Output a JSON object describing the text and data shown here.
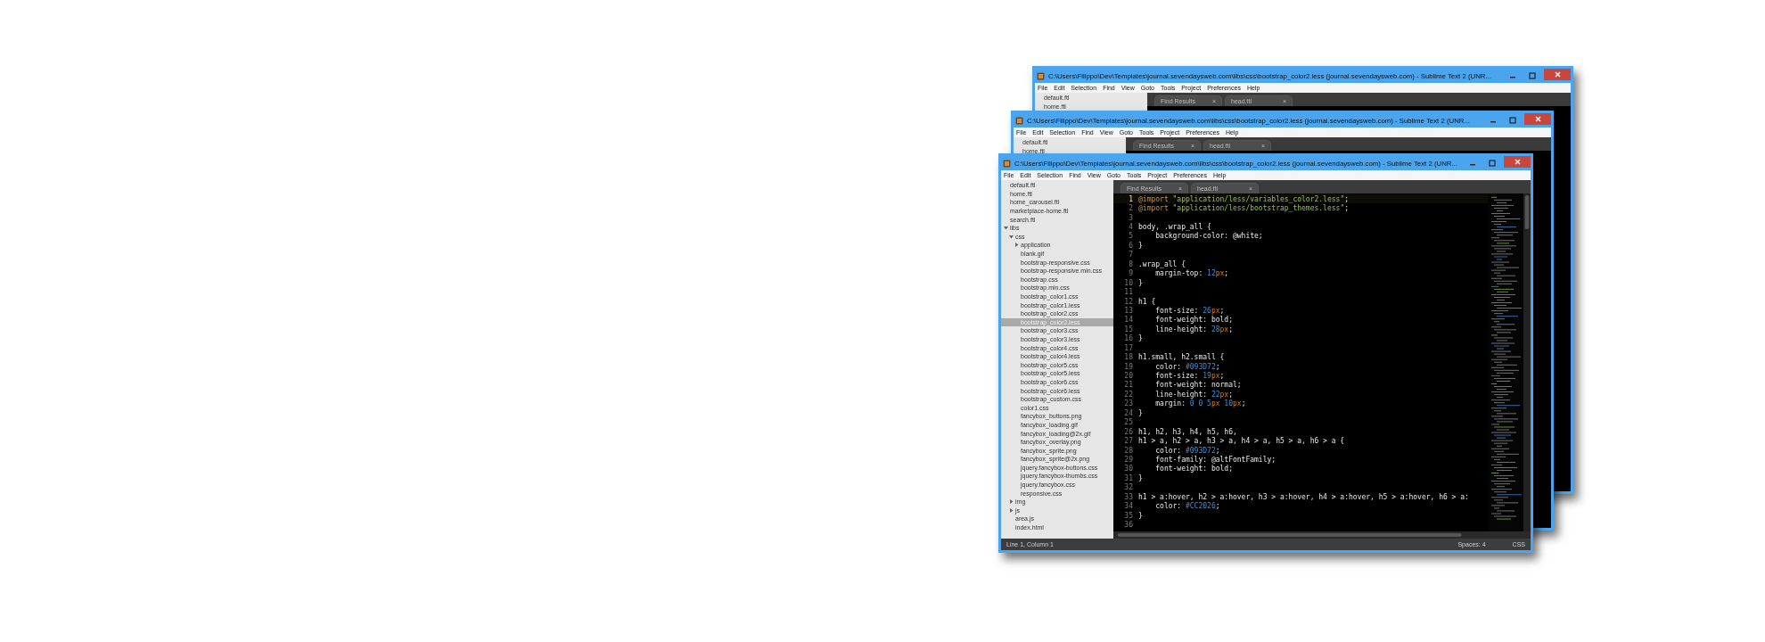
{
  "windows": [
    {
      "title": "C:\\Users\\Filippo\\Dev\\Templates\\journal.sevendaysweb.com\\libs\\css\\bootstrap_color2.less (journal.sevendaysweb.com) - Sublime Text 2 (UNR...",
      "menu": [
        "File",
        "Edit",
        "Selection",
        "Find",
        "View",
        "Goto",
        "Tools",
        "Project",
        "Preferences",
        "Help"
      ],
      "sidebar": {
        "items": [
          {
            "kind": "file",
            "label": "default.ftl",
            "selected": false
          },
          {
            "kind": "file",
            "label": "home.ftl",
            "selected": false
          }
        ]
      },
      "tabs": [
        {
          "label": "Find Results",
          "close": "×",
          "selected": false
        },
        {
          "label": "head.ftl",
          "close": "×",
          "selected": false
        }
      ]
    },
    {
      "title": "C:\\Users\\Filippo\\Dev\\Templates\\journal.sevendaysweb.com\\libs\\css\\bootstrap_color2.less (journal.sevendaysweb.com) - Sublime Text 2 (UNR...",
      "menu": [
        "File",
        "Edit",
        "Selection",
        "Find",
        "View",
        "Goto",
        "Tools",
        "Project",
        "Preferences",
        "Help"
      ],
      "sidebar": {
        "items": [
          {
            "kind": "file",
            "label": "default.ftl",
            "selected": false
          },
          {
            "kind": "file",
            "label": "home.ftl",
            "selected": false
          }
        ]
      },
      "tabs": [
        {
          "label": "Find Results",
          "close": "×",
          "selected": false
        },
        {
          "label": "head.ftl",
          "close": "×",
          "selected": false
        }
      ]
    },
    {
      "title": "C:\\Users\\Filippo\\Dev\\Templates\\journal.sevendaysweb.com\\libs\\css\\bootstrap_color2.less (journal.sevendaysweb.com) - Sublime Text 2 (UNR...",
      "menu": [
        "File",
        "Edit",
        "Selection",
        "Find",
        "View",
        "Goto",
        "Tools",
        "Project",
        "Preferences",
        "Help"
      ],
      "sidebar": {
        "items": [
          {
            "kind": "file",
            "label": "default.ftl",
            "selected": false
          },
          {
            "kind": "file",
            "label": "home.ftl",
            "selected": false
          },
          {
            "kind": "file",
            "label": "home_carousel.ftl",
            "selected": false
          },
          {
            "kind": "file",
            "label": "marketplace-home.ftl",
            "selected": false
          },
          {
            "kind": "file",
            "label": "search.ftl",
            "selected": false
          },
          {
            "kind": "folder",
            "label": "libs",
            "selected": false,
            "expanded": true,
            "children": [
              {
                "kind": "folder",
                "label": "css",
                "selected": false,
                "expanded": true,
                "children": [
                  {
                    "kind": "folder",
                    "label": "application",
                    "selected": false,
                    "expanded": false
                  },
                  {
                    "kind": "file",
                    "label": "blank.gif",
                    "selected": false
                  },
                  {
                    "kind": "file",
                    "label": "bootstrap-responsive.css",
                    "selected": false
                  },
                  {
                    "kind": "file",
                    "label": "bootstrap-responsive.min.css",
                    "selected": false
                  },
                  {
                    "kind": "file",
                    "label": "bootstrap.css",
                    "selected": false
                  },
                  {
                    "kind": "file",
                    "label": "bootstrap.min.css",
                    "selected": false
                  },
                  {
                    "kind": "file",
                    "label": "bootstrap_color1.css",
                    "selected": false
                  },
                  {
                    "kind": "file",
                    "label": "bootstrap_color1.less",
                    "selected": false
                  },
                  {
                    "kind": "file",
                    "label": "bootstrap_color2.css",
                    "selected": false
                  },
                  {
                    "kind": "file",
                    "label": "bootstrap_color2.less",
                    "selected": true
                  },
                  {
                    "kind": "file",
                    "label": "bootstrap_color3.css",
                    "selected": false
                  },
                  {
                    "kind": "file",
                    "label": "bootstrap_color3.less",
                    "selected": false
                  },
                  {
                    "kind": "file",
                    "label": "bootstrap_color4.css",
                    "selected": false
                  },
                  {
                    "kind": "file",
                    "label": "bootstrap_color4.less",
                    "selected": false
                  },
                  {
                    "kind": "file",
                    "label": "bootstrap_color5.css",
                    "selected": false
                  },
                  {
                    "kind": "file",
                    "label": "bootstrap_color5.less",
                    "selected": false
                  },
                  {
                    "kind": "file",
                    "label": "bootstrap_color6.css",
                    "selected": false
                  },
                  {
                    "kind": "file",
                    "label": "bootstrap_color6.less",
                    "selected": false
                  },
                  {
                    "kind": "file",
                    "label": "bootstrap_custom.css",
                    "selected": false
                  },
                  {
                    "kind": "file",
                    "label": "color1.css",
                    "selected": false
                  },
                  {
                    "kind": "file",
                    "label": "fancybox_buttons.png",
                    "selected": false
                  },
                  {
                    "kind": "file",
                    "label": "fancybox_loading.gif",
                    "selected": false
                  },
                  {
                    "kind": "file",
                    "label": "fancybox_loading@2x.gif",
                    "selected": false
                  },
                  {
                    "kind": "file",
                    "label": "fancybox_overlay.png",
                    "selected": false
                  },
                  {
                    "kind": "file",
                    "label": "fancybox_sprite.png",
                    "selected": false
                  },
                  {
                    "kind": "file",
                    "label": "fancybox_sprite@2x.png",
                    "selected": false
                  },
                  {
                    "kind": "file",
                    "label": "jquery.fancybox-buttons.css",
                    "selected": false
                  },
                  {
                    "kind": "file",
                    "label": "jquery.fancybox-thumbs.css",
                    "selected": false
                  },
                  {
                    "kind": "file",
                    "label": "jquery.fancybox.css",
                    "selected": false
                  },
                  {
                    "kind": "file",
                    "label": "responsive.css",
                    "selected": false
                  }
                ]
              },
              {
                "kind": "folder",
                "label": "img",
                "selected": false,
                "expanded": false
              },
              {
                "kind": "folder",
                "label": "js",
                "selected": false,
                "expanded": false
              },
              {
                "kind": "file",
                "label": "area.js",
                "selected": false
              },
              {
                "kind": "file",
                "label": "index.html",
                "selected": false
              }
            ]
          }
        ]
      },
      "tabs": [
        {
          "label": "Find Results",
          "close": "×",
          "selected": false
        },
        {
          "label": "head.ftl",
          "close": "×",
          "selected": false
        }
      ],
      "editor": {
        "lines": [
          {
            "number": "1",
            "current": true,
            "parts": [
              {
                "kind": "keyword",
                "text": "@import"
              },
              {
                "kind": "string",
                "text": " \"application/less/variables_color2.less\""
              },
              {
                "kind": "text",
                "text": ";"
              }
            ]
          },
          {
            "number": "2",
            "current": false,
            "parts": [
              {
                "kind": "keyword",
                "text": "@import"
              },
              {
                "kind": "string",
                "text": " \"application/less/bootstrap_themes.less\""
              },
              {
                "kind": "text",
                "text": ";"
              }
            ]
          },
          {
            "number": "3",
            "current": false
          },
          {
            "number": "4",
            "current": false,
            "parts": [
              {
                "kind": "text",
                "text": "body, .wrap_all {"
              }
            ]
          },
          {
            "number": "5",
            "current": false,
            "parts": [
              {
                "kind": "text",
                "text": "    background-color: @white;"
              }
            ]
          },
          {
            "number": "6",
            "current": false,
            "parts": [
              {
                "kind": "text",
                "text": "}"
              }
            ]
          },
          {
            "number": "7",
            "current": false
          },
          {
            "number": "8",
            "current": false,
            "parts": [
              {
                "kind": "text",
                "text": ".wrap_all {"
              }
            ]
          },
          {
            "number": "9",
            "current": false,
            "parts": [
              {
                "kind": "text",
                "text": "    margin-top: "
              },
              {
                "kind": "number",
                "text": "12"
              },
              {
                "kind": "unit",
                "text": "px"
              },
              {
                "kind": "text",
                "text": ";"
              }
            ]
          },
          {
            "number": "10",
            "current": false,
            "parts": [
              {
                "kind": "text",
                "text": "}"
              }
            ]
          },
          {
            "number": "11",
            "current": false
          },
          {
            "number": "12",
            "current": false,
            "parts": [
              {
                "kind": "text",
                "text": "h1 {"
              }
            ]
          },
          {
            "number": "13",
            "current": false,
            "parts": [
              {
                "kind": "text",
                "text": "    font-size: "
              },
              {
                "kind": "number",
                "text": "26"
              },
              {
                "kind": "unit",
                "text": "px"
              },
              {
                "kind": "text",
                "text": ";"
              }
            ]
          },
          {
            "number": "14",
            "current": false,
            "parts": [
              {
                "kind": "text",
                "text": "    font-weight: bold;"
              }
            ]
          },
          {
            "number": "15",
            "current": false,
            "parts": [
              {
                "kind": "text",
                "text": "    line-height: "
              },
              {
                "kind": "number",
                "text": "28"
              },
              {
                "kind": "unit",
                "text": "px"
              },
              {
                "kind": "text",
                "text": ";"
              }
            ]
          },
          {
            "number": "16",
            "current": false,
            "parts": [
              {
                "kind": "text",
                "text": "}"
              }
            ]
          },
          {
            "number": "17",
            "current": false
          },
          {
            "number": "18",
            "current": false,
            "parts": [
              {
                "kind": "text",
                "text": "h1.small, h2.small {"
              }
            ]
          },
          {
            "number": "19",
            "current": false,
            "parts": [
              {
                "kind": "text",
                "text": "    color: "
              },
              {
                "kind": "number",
                "text": "#093D72"
              },
              {
                "kind": "text",
                "text": ";"
              }
            ]
          },
          {
            "number": "20",
            "current": false,
            "parts": [
              {
                "kind": "text",
                "text": "    font-size: "
              },
              {
                "kind": "number",
                "text": "19"
              },
              {
                "kind": "unit",
                "text": "px"
              },
              {
                "kind": "text",
                "text": ";"
              }
            ]
          },
          {
            "number": "21",
            "current": false,
            "parts": [
              {
                "kind": "text",
                "text": "    font-weight: normal;"
              }
            ]
          },
          {
            "number": "22",
            "current": false,
            "parts": [
              {
                "kind": "text",
                "text": "    line-height: "
              },
              {
                "kind": "number",
                "text": "22"
              },
              {
                "kind": "unit",
                "text": "px"
              },
              {
                "kind": "text",
                "text": ";"
              }
            ]
          },
          {
            "number": "23",
            "current": false,
            "parts": [
              {
                "kind": "text",
                "text": "    margin: "
              },
              {
                "kind": "number",
                "text": "0 0 5"
              },
              {
                "kind": "unit",
                "text": "px"
              },
              {
                "kind": "number",
                "text": " 10"
              },
              {
                "kind": "unit",
                "text": "px"
              },
              {
                "kind": "text",
                "text": ";"
              }
            ]
          },
          {
            "number": "24",
            "current": false,
            "parts": [
              {
                "kind": "text",
                "text": "}"
              }
            ]
          },
          {
            "number": "25",
            "current": false
          },
          {
            "number": "26",
            "current": false,
            "parts": [
              {
                "kind": "text",
                "text": "h1, h2, h3, h4, h5, h6,"
              }
            ]
          },
          {
            "number": "27",
            "current": false,
            "parts": [
              {
                "kind": "text",
                "text": "h1 > a, h2 > a, h3 > a, h4 > a, h5 > a, h6 > a {"
              }
            ]
          },
          {
            "number": "28",
            "current": false,
            "parts": [
              {
                "kind": "text",
                "text": "    color: "
              },
              {
                "kind": "number",
                "text": "#093D72"
              },
              {
                "kind": "text",
                "text": ";"
              }
            ]
          },
          {
            "number": "29",
            "current": false,
            "parts": [
              {
                "kind": "text",
                "text": "    font-family: @altFontFamily;"
              }
            ]
          },
          {
            "number": "30",
            "current": false,
            "parts": [
              {
                "kind": "text",
                "text": "    font-weight: bold;"
              }
            ]
          },
          {
            "number": "31",
            "current": false,
            "parts": [
              {
                "kind": "text",
                "text": "}"
              }
            ]
          },
          {
            "number": "32",
            "current": false
          },
          {
            "number": "33",
            "current": false,
            "parts": [
              {
                "kind": "text",
                "text": "h1 > a:hover, h2 > a:hover, h3 > a:hover, h4 > a:hover, h5 > a:hover, h6 > a:"
              }
            ]
          },
          {
            "number": "34",
            "current": false,
            "parts": [
              {
                "kind": "text",
                "text": "    color: "
              },
              {
                "kind": "number",
                "text": "#CC2026"
              },
              {
                "kind": "text",
                "text": ";"
              }
            ]
          },
          {
            "number": "35",
            "current": false,
            "parts": [
              {
                "kind": "text",
                "text": "}"
              }
            ]
          },
          {
            "number": "36",
            "current": false
          }
        ]
      },
      "status_bar": {
        "position": "Line 1, Column 1",
        "indentation": "Spaces: 4",
        "syntax": "CSS"
      }
    }
  ]
}
